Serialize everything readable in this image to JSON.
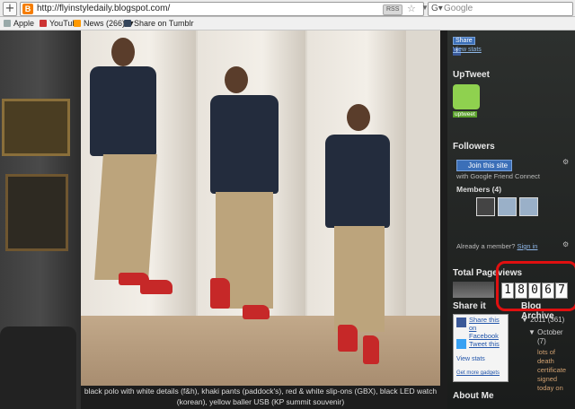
{
  "browser": {
    "url": "http://flyinstyledaily.blogspot.com/",
    "rss_label": "RSS",
    "search_placeholder": "Google",
    "bookmarks": [
      {
        "label": "Apple",
        "icon": "apple-icon"
      },
      {
        "label": "YouTube",
        "icon": "youtube-icon"
      },
      {
        "label": "News (266)",
        "icon": "rss-icon"
      },
      {
        "label": "Share on Tumblr",
        "icon": "tumblr-icon"
      }
    ]
  },
  "post": {
    "caption_line1": "black polo with white details (f&h), khaki pants (paddock's), red & white slip-ons (GBX), black LED watch",
    "caption_line2": "(korean), yellow baller USB (KP summit souvenir)"
  },
  "sidebar": {
    "share_label": "Share",
    "view_stats_1": "View stats",
    "uptweet_title": "UpTweet",
    "uptweet_badge": "uptweet",
    "followers_title": "Followers",
    "join_button": "Join this site",
    "friend_connect": "with Google Friend Connect",
    "members_label": "Members (4)",
    "already_member": "Already a member?",
    "sign_in": "Sign in",
    "pageviews_title": "Total Pageviews",
    "pageview_digits": [
      "1",
      "8",
      "0",
      "6",
      "7"
    ],
    "share_it_title": "Share it",
    "share_facebook": "Share this on Facebook",
    "tweet_this": "Tweet this",
    "view_stats_2": "View stats",
    "get_more": "Get more gadgets",
    "archive_title": "Blog Archive",
    "archive_year": "2011",
    "archive_year_count": "(361)",
    "archive_month": "October",
    "archive_month_count": "(7)",
    "archive_post": "lots of death certificate signed today on",
    "about_title": "About Me"
  },
  "colors": {
    "highlight": "#e01010",
    "link": "#8fb8e8",
    "blogger_orange": "#f57d00"
  }
}
